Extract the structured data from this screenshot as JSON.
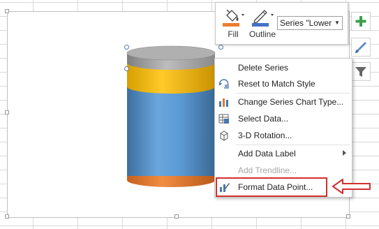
{
  "toolbar": {
    "fill_label": "Fill",
    "outline_label": "Outline",
    "series_select_value": "Series \"Lower C"
  },
  "context_menu": {
    "items": [
      {
        "label": "Delete Series",
        "icon": "none"
      },
      {
        "label": "Reset to Match Style",
        "icon": "reset-style-icon"
      },
      {
        "label": "Change Series Chart Type...",
        "icon": "chart-type-icon"
      },
      {
        "label": "Select Data...",
        "icon": "select-data-icon"
      },
      {
        "label": "3-D Rotation...",
        "icon": "rotation-3d-icon"
      },
      {
        "label": "Add Data Label",
        "icon": "none",
        "submenu": true
      },
      {
        "label": "Add Trendline...",
        "icon": "none",
        "disabled": true
      },
      {
        "label": "Format Data Point...",
        "icon": "format-data-point-icon"
      }
    ]
  },
  "side_buttons": [
    "plus-icon",
    "brush-icon",
    "filter-icon"
  ],
  "colors": {
    "cylinder_top": "#a8a8a8",
    "band_yellow": "#ffc000",
    "body_blue": "#5b9bd5",
    "base_orange": "#ed7d31",
    "annotation_red": "#d32f2f",
    "fill_swatch": "#ed7d31",
    "outline_swatch": "#4472c4"
  }
}
